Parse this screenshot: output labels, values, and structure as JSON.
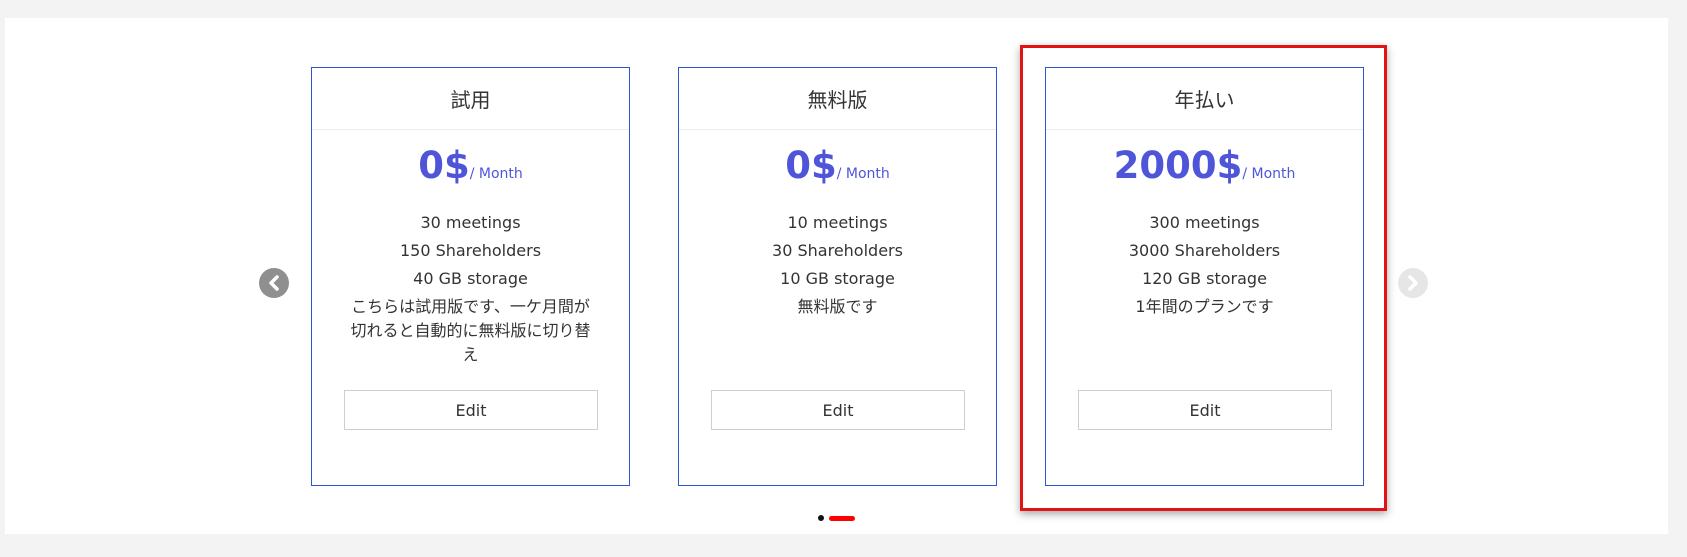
{
  "plans": [
    {
      "name": "試用",
      "price": "0$",
      "period": "/ Month",
      "features": [
        "30 meetings",
        "150 Shareholders",
        "40 GB storage"
      ],
      "note": "こちらは試用版です、一ケ月間が切れると自動的に無料版に切り替え",
      "edit_label": "Edit"
    },
    {
      "name": "無料版",
      "price": "0$",
      "period": "/ Month",
      "features": [
        "10 meetings",
        "30 Shareholders",
        "10 GB storage"
      ],
      "note": "無料版です",
      "edit_label": "Edit"
    },
    {
      "name": "年払い",
      "price": "2000$",
      "period": "/ Month",
      "features": [
        "300 meetings",
        "3000 Shareholders",
        "120 GB storage"
      ],
      "note": "1年間のプランです",
      "edit_label": "Edit"
    }
  ],
  "carousel": {
    "prev_icon": "chevron-left-icon",
    "next_icon": "chevron-right-icon",
    "slide_count": 2,
    "active_slide": 2
  },
  "colors": {
    "card_border": "#2f56d2",
    "price": "#4f55d8",
    "highlight": "#e21313",
    "active_dot": "#ff0000"
  }
}
